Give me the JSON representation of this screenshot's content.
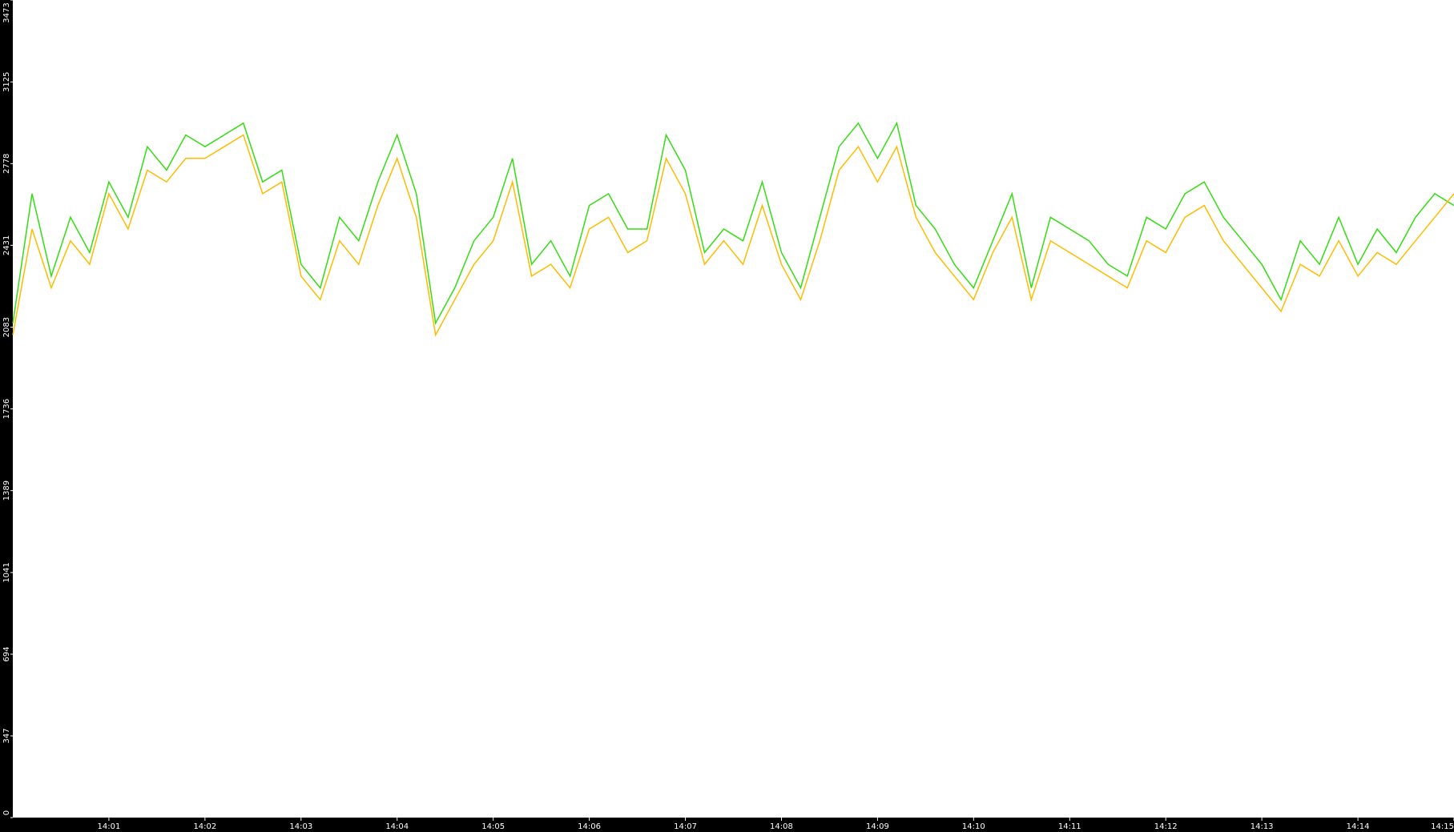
{
  "chart_data": {
    "type": "line",
    "title": "",
    "xlabel": "",
    "ylabel": "",
    "ylim": [
      0,
      3473
    ],
    "yticks": [
      "0",
      "347",
      "694",
      "1041",
      "1389",
      "1736",
      "2083",
      "2431",
      "2778",
      "3125",
      "3473"
    ],
    "xticks": [
      "14:01",
      "14:02",
      "14:03",
      "14:04",
      "14:05",
      "14:06",
      "14:07",
      "14:08",
      "14:09",
      "14:10",
      "14:11",
      "14:12",
      "14:13",
      "14:14",
      "14:15"
    ],
    "x_range_minutes": [
      0,
      15
    ],
    "grid": false,
    "legend": "none",
    "colors": {
      "series_a": "#33dd11",
      "series_b": "#ffbb00",
      "axis": "#000000",
      "tick_text": "#ffffff"
    },
    "series": [
      {
        "color": "#33dd11",
        "points": [
          [
            0.0,
            2100
          ],
          [
            0.2,
            2650
          ],
          [
            0.4,
            2300
          ],
          [
            0.6,
            2550
          ],
          [
            0.8,
            2400
          ],
          [
            1.0,
            2700
          ],
          [
            1.2,
            2550
          ],
          [
            1.4,
            2850
          ],
          [
            1.6,
            2750
          ],
          [
            1.8,
            2900
          ],
          [
            2.0,
            2850
          ],
          [
            2.2,
            2900
          ],
          [
            2.4,
            2950
          ],
          [
            2.6,
            2700
          ],
          [
            2.8,
            2750
          ],
          [
            3.0,
            2350
          ],
          [
            3.2,
            2250
          ],
          [
            3.4,
            2550
          ],
          [
            3.6,
            2450
          ],
          [
            3.8,
            2700
          ],
          [
            4.0,
            2900
          ],
          [
            4.2,
            2650
          ],
          [
            4.4,
            2100
          ],
          [
            4.6,
            2250
          ],
          [
            4.8,
            2450
          ],
          [
            5.0,
            2550
          ],
          [
            5.2,
            2800
          ],
          [
            5.4,
            2350
          ],
          [
            5.6,
            2450
          ],
          [
            5.8,
            2300
          ],
          [
            6.0,
            2600
          ],
          [
            6.2,
            2650
          ],
          [
            6.4,
            2500
          ],
          [
            6.6,
            2500
          ],
          [
            6.8,
            2900
          ],
          [
            7.0,
            2750
          ],
          [
            7.2,
            2400
          ],
          [
            7.4,
            2500
          ],
          [
            7.6,
            2450
          ],
          [
            7.8,
            2700
          ],
          [
            8.0,
            2400
          ],
          [
            8.2,
            2250
          ],
          [
            8.4,
            2550
          ],
          [
            8.6,
            2850
          ],
          [
            8.8,
            2950
          ],
          [
            9.0,
            2800
          ],
          [
            9.2,
            2950
          ],
          [
            9.4,
            2600
          ],
          [
            9.6,
            2500
          ],
          [
            9.8,
            2350
          ],
          [
            10.0,
            2250
          ],
          [
            10.2,
            2450
          ],
          [
            10.4,
            2650
          ],
          [
            10.6,
            2250
          ],
          [
            10.8,
            2550
          ],
          [
            11.0,
            2500
          ],
          [
            11.2,
            2450
          ],
          [
            11.4,
            2350
          ],
          [
            11.6,
            2300
          ],
          [
            11.8,
            2550
          ],
          [
            12.0,
            2500
          ],
          [
            12.2,
            2650
          ],
          [
            12.4,
            2700
          ],
          [
            12.6,
            2550
          ],
          [
            12.8,
            2450
          ],
          [
            13.0,
            2350
          ],
          [
            13.2,
            2200
          ],
          [
            13.4,
            2450
          ],
          [
            13.6,
            2350
          ],
          [
            13.8,
            2550
          ],
          [
            14.0,
            2350
          ],
          [
            14.2,
            2500
          ],
          [
            14.4,
            2400
          ],
          [
            14.6,
            2550
          ],
          [
            14.8,
            2650
          ],
          [
            15.0,
            2600
          ]
        ]
      },
      {
        "color": "#ffbb00",
        "points": [
          [
            0.0,
            2050
          ],
          [
            0.2,
            2500
          ],
          [
            0.4,
            2250
          ],
          [
            0.6,
            2450
          ],
          [
            0.8,
            2350
          ],
          [
            1.0,
            2650
          ],
          [
            1.2,
            2500
          ],
          [
            1.4,
            2750
          ],
          [
            1.6,
            2700
          ],
          [
            1.8,
            2800
          ],
          [
            2.0,
            2800
          ],
          [
            2.2,
            2850
          ],
          [
            2.4,
            2900
          ],
          [
            2.6,
            2650
          ],
          [
            2.8,
            2700
          ],
          [
            3.0,
            2300
          ],
          [
            3.2,
            2200
          ],
          [
            3.4,
            2450
          ],
          [
            3.6,
            2350
          ],
          [
            3.8,
            2600
          ],
          [
            4.0,
            2800
          ],
          [
            4.2,
            2550
          ],
          [
            4.4,
            2050
          ],
          [
            4.6,
            2200
          ],
          [
            4.8,
            2350
          ],
          [
            5.0,
            2450
          ],
          [
            5.2,
            2700
          ],
          [
            5.4,
            2300
          ],
          [
            5.6,
            2350
          ],
          [
            5.8,
            2250
          ],
          [
            6.0,
            2500
          ],
          [
            6.2,
            2550
          ],
          [
            6.4,
            2400
          ],
          [
            6.6,
            2450
          ],
          [
            6.8,
            2800
          ],
          [
            7.0,
            2650
          ],
          [
            7.2,
            2350
          ],
          [
            7.4,
            2450
          ],
          [
            7.6,
            2350
          ],
          [
            7.8,
            2600
          ],
          [
            8.0,
            2350
          ],
          [
            8.2,
            2200
          ],
          [
            8.4,
            2450
          ],
          [
            8.6,
            2750
          ],
          [
            8.8,
            2850
          ],
          [
            9.0,
            2700
          ],
          [
            9.2,
            2850
          ],
          [
            9.4,
            2550
          ],
          [
            9.6,
            2400
          ],
          [
            9.8,
            2300
          ],
          [
            10.0,
            2200
          ],
          [
            10.2,
            2400
          ],
          [
            10.4,
            2550
          ],
          [
            10.6,
            2200
          ],
          [
            10.8,
            2450
          ],
          [
            11.0,
            2400
          ],
          [
            11.2,
            2350
          ],
          [
            11.4,
            2300
          ],
          [
            11.6,
            2250
          ],
          [
            11.8,
            2450
          ],
          [
            12.0,
            2400
          ],
          [
            12.2,
            2550
          ],
          [
            12.4,
            2600
          ],
          [
            12.6,
            2450
          ],
          [
            12.8,
            2350
          ],
          [
            13.0,
            2250
          ],
          [
            13.2,
            2150
          ],
          [
            13.4,
            2350
          ],
          [
            13.6,
            2300
          ],
          [
            13.8,
            2450
          ],
          [
            14.0,
            2300
          ],
          [
            14.2,
            2400
          ],
          [
            14.4,
            2350
          ],
          [
            14.6,
            2450
          ],
          [
            14.8,
            2550
          ],
          [
            15.0,
            2650
          ]
        ]
      }
    ]
  }
}
